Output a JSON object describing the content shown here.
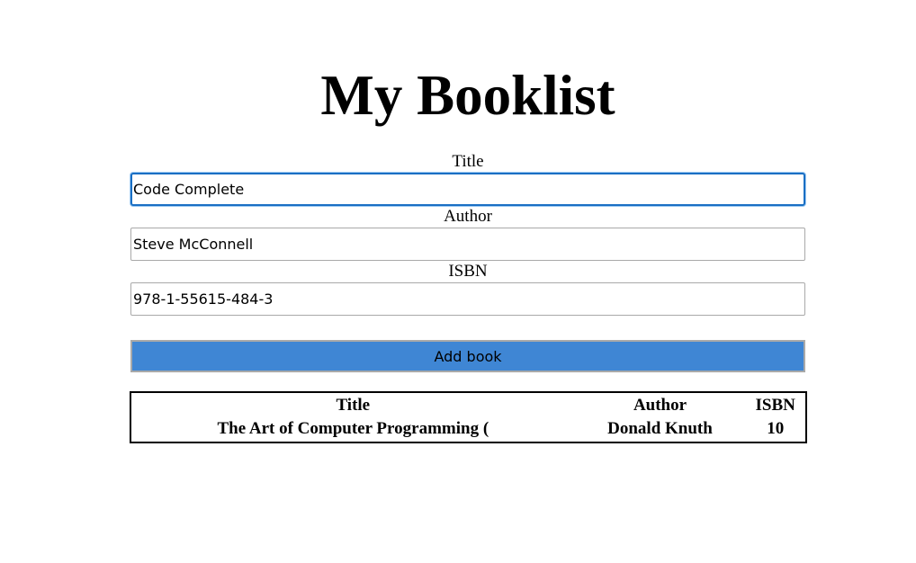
{
  "page": {
    "title": "My Booklist"
  },
  "form": {
    "title_label": "Title",
    "title_value": "Code Complete",
    "author_label": "Author",
    "author_value": "Steve McConnell",
    "isbn_label": "ISBN",
    "isbn_value": "978-1-55615-484-3",
    "submit_label": "Add book"
  },
  "table": {
    "headers": [
      "Title",
      "Author",
      "ISBN"
    ],
    "rows": [
      [
        "The Art of Computer Programming (",
        "Donald Knuth",
        "10"
      ]
    ]
  },
  "colors": {
    "button_bg": "#3f86d4",
    "focus_border": "#1a6fc4"
  }
}
